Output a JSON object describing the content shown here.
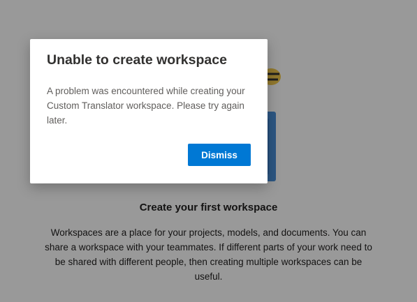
{
  "background": {
    "title": "Create your first workspace",
    "description": "Workspaces are a place for your projects, models, and documents. You can share a workspace with your teammates. If different parts of your work need to be shared with different people, then creating multiple workspaces can be useful."
  },
  "dialog": {
    "title": "Unable to create workspace",
    "message": "A problem was encountered while creating your Custom Translator workspace. Please try again later.",
    "dismiss_label": "Dismiss"
  },
  "colors": {
    "primary": "#0078d4",
    "overlay": "rgba(0,0,0,0.4)",
    "illustration_blue": "#4a90d9",
    "illustration_yellow": "#f2c94c"
  },
  "icons": {
    "illustration": "workspace-illustration"
  }
}
